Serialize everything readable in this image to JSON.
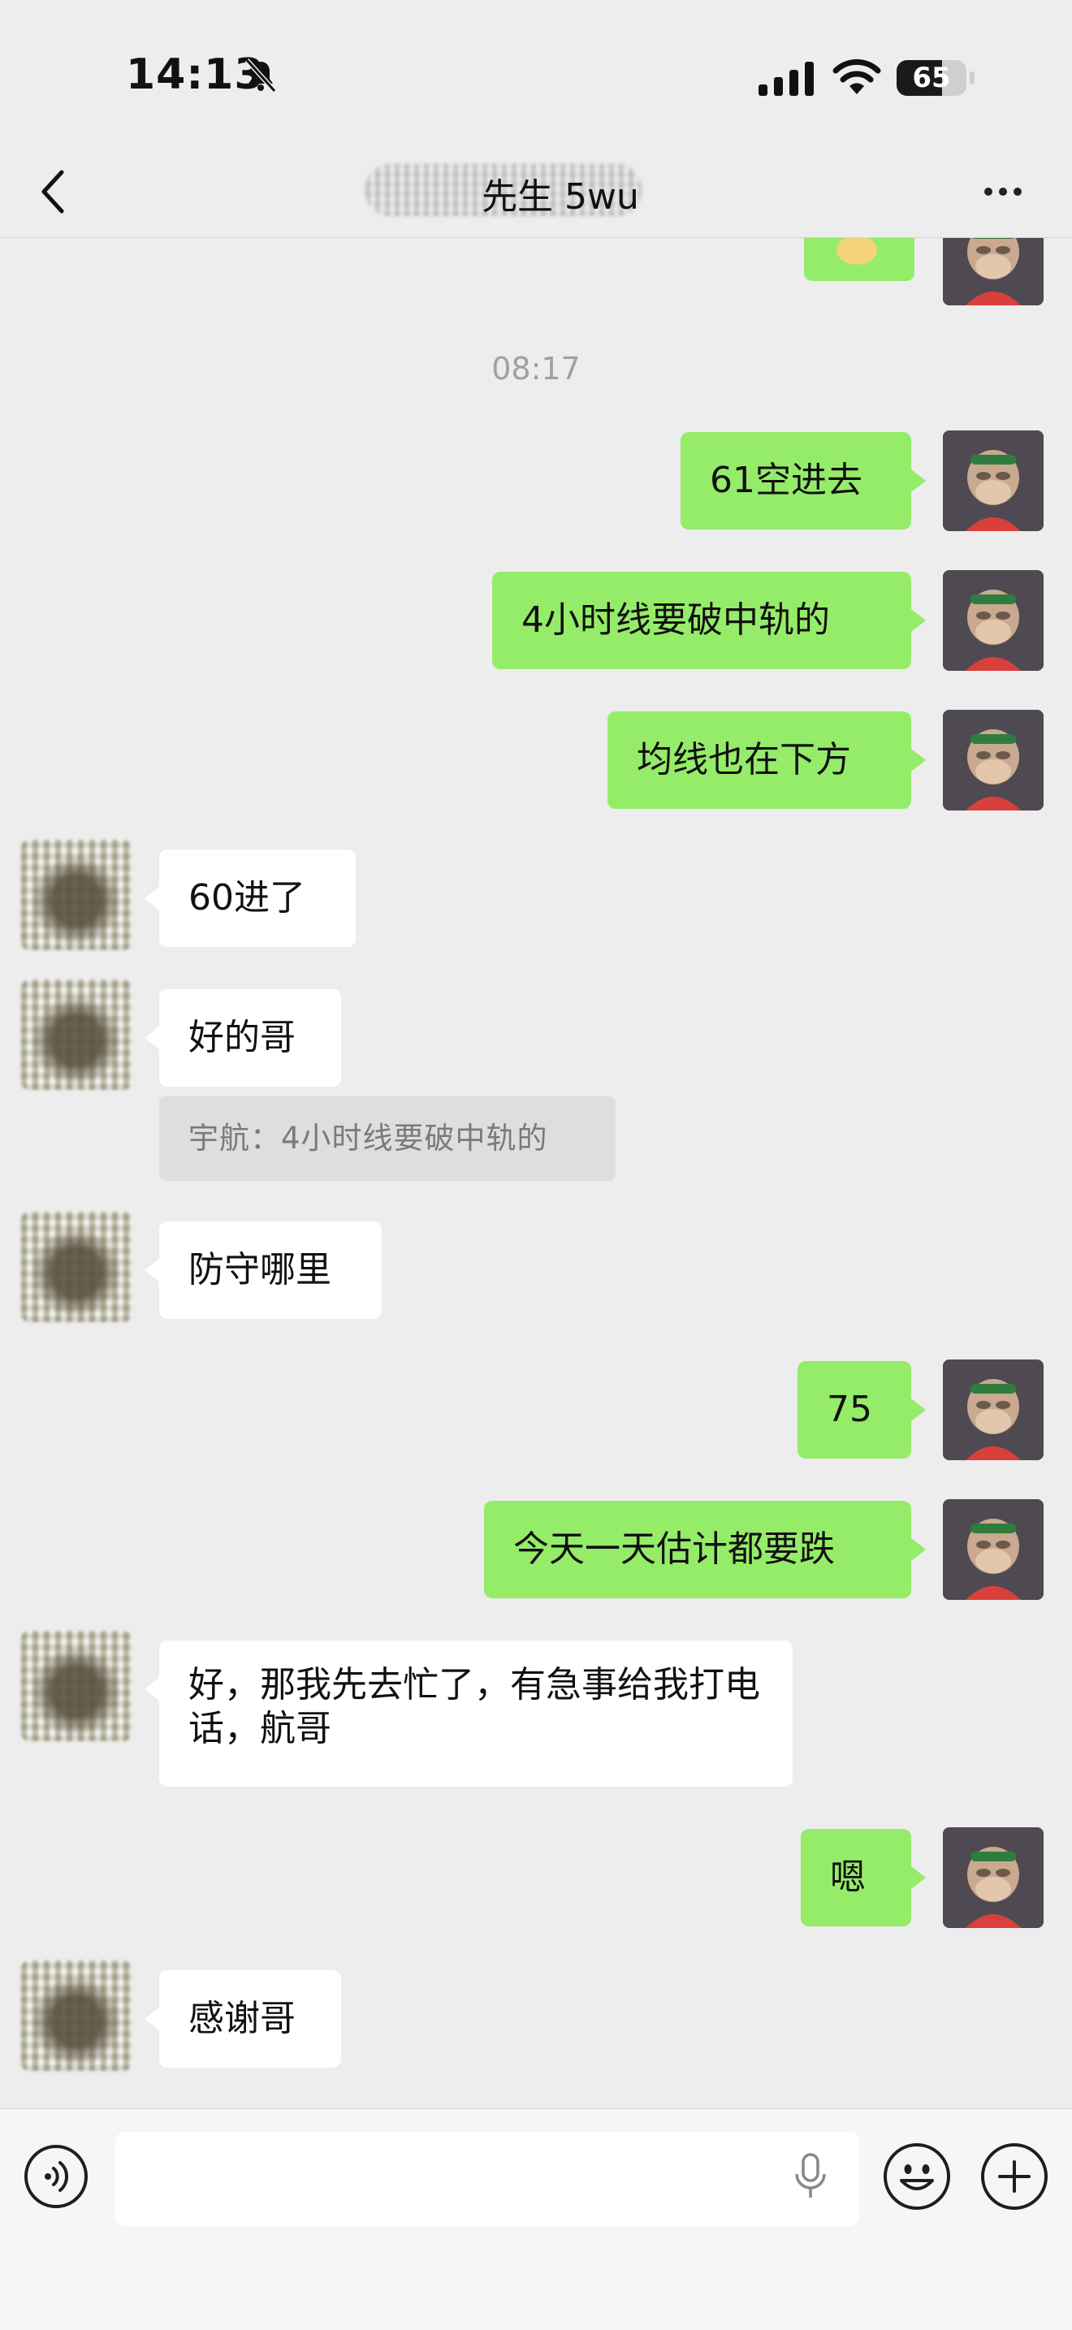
{
  "status_bar": {
    "time": "14:13",
    "battery": "65",
    "battery_level_percent": 65,
    "icons": [
      "mute-bell-icon",
      "cellular-signal-icon",
      "wifi-icon",
      "battery-icon"
    ]
  },
  "nav": {
    "title": "先生 5wu",
    "back_icon": "chevron-left-icon",
    "more_icon": "ellipsis-icon"
  },
  "chat": {
    "timestamp": "08:17",
    "messages": [
      {
        "sender": "me",
        "text": "61空进去"
      },
      {
        "sender": "me",
        "text": "4小时线要破中轨的"
      },
      {
        "sender": "me",
        "text": "均线也在下方"
      },
      {
        "sender": "them",
        "text": "60进了"
      },
      {
        "sender": "them",
        "text": "好的哥"
      },
      {
        "sender": "them",
        "text": "防守哪里"
      },
      {
        "sender": "me",
        "text": "75"
      },
      {
        "sender": "me",
        "text": "今天一天估计都要跌"
      },
      {
        "sender": "them",
        "text": "好，那我先去忙了，有急事给我打电话，航哥"
      },
      {
        "sender": "me",
        "text": "嗯"
      },
      {
        "sender": "them",
        "text": "感谢哥"
      }
    ],
    "quote": "宇航：4小时线要破中轨的"
  },
  "input_bar": {
    "voice_icon": "voice-mode-icon",
    "message_value": "",
    "mic_icon": "microphone-icon",
    "emoji_icon": "emoji-face-icon",
    "add_icon": "plus-icon"
  },
  "colors": {
    "background": "#ededed",
    "my_bubble": "#95ec69",
    "their_bubble": "#ffffff",
    "timestamp": "#a0a0a0",
    "quote_bg": "#dedede"
  }
}
